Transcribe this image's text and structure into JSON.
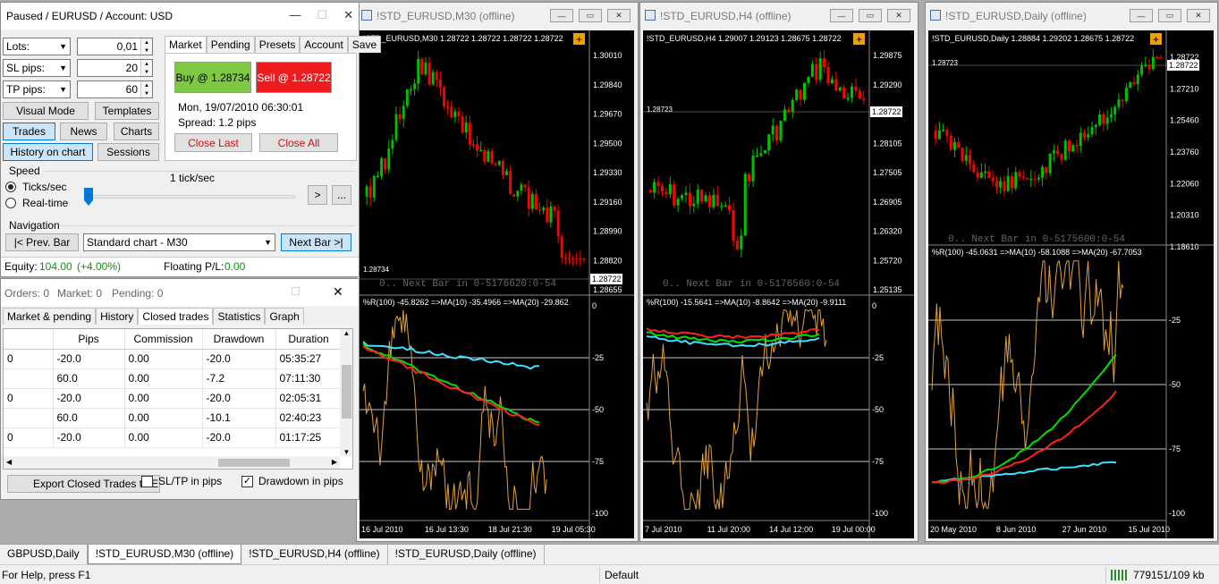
{
  "control": {
    "title": "Paused / EURUSD / Account: USD",
    "lots_label": "Lots:",
    "lots_value": "0,01",
    "sl_label": "SL pips:",
    "sl_value": "20",
    "tp_label": "TP pips:",
    "tp_value": "60",
    "visual_mode": "Visual Mode",
    "templates": "Templates",
    "trades": "Trades",
    "news": "News",
    "charts": "Charts",
    "history_on_chart": "History on chart",
    "sessions": "Sessions",
    "tabs": [
      "Market",
      "Pending",
      "Presets",
      "Account",
      "Save"
    ],
    "buy": "Buy @ 1.28734",
    "sell": "Sell @ 1.28722",
    "datetime": "Mon, 19/07/2010  06:30:01",
    "spread": "Spread: 1.2 pips",
    "close_last": "Close Last",
    "close_all": "Close All",
    "speed_label": "Speed",
    "speed_value": "1 tick/sec",
    "ticks_sec": "Ticks/sec",
    "real_time": "Real-time",
    "play": ">",
    "more": "...",
    "navigation_label": "Navigation",
    "prev_bar": "|< Prev. Bar",
    "chart_select": "Standard chart - M30",
    "next_bar": "Next Bar >|",
    "equity_label": "Equity:",
    "equity_value": "104.00",
    "equity_change": "(+4.00%)",
    "floating_label": "Floating P/L:",
    "floating_value": "0.00"
  },
  "orders": {
    "summary": {
      "orders": "Orders: 0",
      "market": "Market: 0",
      "pending": "Pending: 0"
    },
    "tabs": [
      "Market & pending",
      "History",
      "Closed trades",
      "Statistics",
      "Graph"
    ],
    "columns": [
      "",
      "Pips",
      "Commission",
      "Drawdown",
      "Duration"
    ],
    "rows": [
      [
        "0",
        "-20.0",
        "0.00",
        "-20.0",
        "05:35:27"
      ],
      [
        "",
        "60.0",
        "0.00",
        "-7.2",
        "07:11:30"
      ],
      [
        "0",
        "-20.0",
        "0.00",
        "-20.0",
        "02:05:31"
      ],
      [
        "",
        "60.0",
        "0.00",
        "-10.1",
        "02:40:23"
      ],
      [
        "0",
        "-20.0",
        "0.00",
        "-20.0",
        "01:17:25"
      ]
    ],
    "export_button": "Export Closed Trades to E",
    "sltp_label": "SL/TP in pips",
    "drawdown_label": "Drawdown in pips"
  },
  "charts": [
    {
      "title": "!STD_EURUSD,M30 (offline)",
      "header": "!STD_EURUSD,M30  1.28722  1.28722  1.28722  1.28722",
      "price_labels": [
        "1.30010",
        "1.29840",
        "1.29670",
        "1.29500",
        "1.29330",
        "1.29160",
        "1.28990",
        "1.28820",
        "1.28655"
      ],
      "current_price": "1.28722",
      "line_price": "1.28734",
      "next_bar": "0.. Next Bar in 0-5176620:0-54",
      "indicator": "%R(100) -45.8262  =>MA(10) -35.4966  =>MA(20) -29.862",
      "ind_levels": [
        "0",
        "-25",
        "-50",
        "-75",
        "-100"
      ],
      "dates": [
        "16 Jul 2010",
        "16 Jul 13:30",
        "18 Jul 21:30",
        "19 Jul 05:30"
      ]
    },
    {
      "title": "!STD_EURUSD,H4 (offline)",
      "header": "!STD_EURUSD,H4  1.29007  1.29123  1.28675  1.28722",
      "price_labels": [
        "1.29875",
        "1.29290",
        "1.28722",
        "1.28105",
        "1.27505",
        "1.26905",
        "1.26320",
        "1.25720",
        "1.25135"
      ],
      "current_price": "1.28722",
      "line_price": "1.28723",
      "next_bar": "0.. Next Bar in 0-5176560:0-54",
      "indicator": "%R(100) -15.5641  =>MA(10) -8.8642  =>MA(20) -9.9111",
      "ind_levels": [
        "0",
        "-25",
        "-50",
        "-75",
        "-100"
      ],
      "dates": [
        "7 Jul 2010",
        "11 Jul 20:00",
        "14 Jul 12:00",
        "19 Jul 00:00"
      ]
    },
    {
      "title": "!STD_EURUSD,Daily (offline)",
      "header": "!STD_EURUSD,Daily  1.28884  1.29202  1.28675  1.28722",
      "price_labels": [
        "1.28722",
        "1.27210",
        "1.25460",
        "1.23760",
        "1.22060",
        "1.20310",
        "1.18610"
      ],
      "current_price": "1.28722",
      "line_price": "1.28723",
      "next_bar": "0.. Next Bar in 0-5175600:0-54",
      "indicator": "%R(100) -45.0631  =>MA(10) -58.1088  =>MA(20) -67.7053",
      "ind_levels": [
        "-25",
        "-50",
        "-75",
        "-100"
      ],
      "dates": [
        "20 May 2010",
        "8 Jun 2010",
        "27 Jun 2010",
        "15 Jul 2010"
      ]
    }
  ],
  "taskbar": [
    "GBPUSD,Daily",
    "!STD_EURUSD,M30 (offline)",
    "!STD_EURUSD,H4 (offline)",
    "!STD_EURUSD,Daily (offline)"
  ],
  "status": {
    "help": "For Help, press F1",
    "profile": "Default",
    "traffic": "779151/109 kb"
  },
  "colors": {
    "bull": "#00c000",
    "bear": "#ff0000",
    "ma10": "#00e000",
    "ma20": "#ff2020",
    "ma_cyan": "#40e0ff",
    "wpr": "#e0a040",
    "buy_bg": "#7ec843",
    "sell_bg": "#ee1c1c"
  }
}
